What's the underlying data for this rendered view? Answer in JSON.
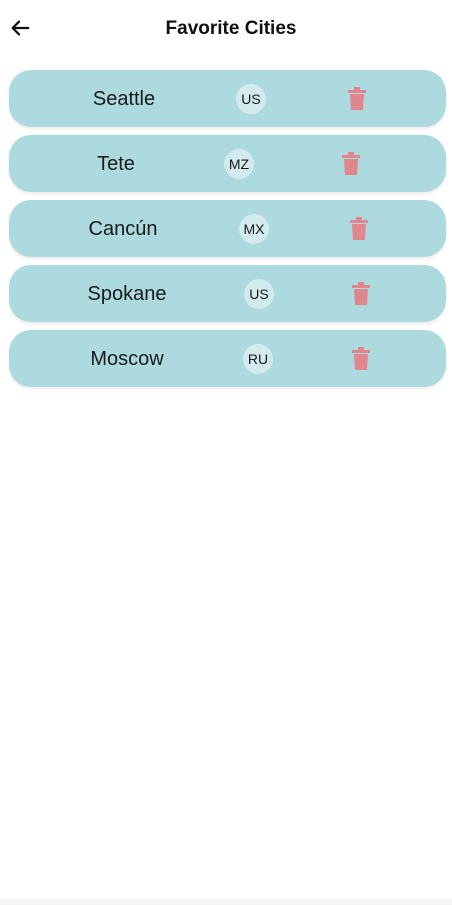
{
  "header": {
    "title": "Favorite Cities",
    "back_icon": "arrow-left-icon"
  },
  "cities": [
    {
      "name": "Seattle",
      "country": "US"
    },
    {
      "name": "Tete",
      "country": "MZ"
    },
    {
      "name": "Cancún",
      "country": "MX"
    },
    {
      "name": "Spokane",
      "country": "US"
    },
    {
      "name": "Moscow",
      "country": "RU"
    }
  ],
  "colors": {
    "card_bg": "#acdadf",
    "badge_bg": "#d3ebee",
    "delete_icon": "#e0868c"
  },
  "icons": {
    "delete": "trash-icon"
  }
}
